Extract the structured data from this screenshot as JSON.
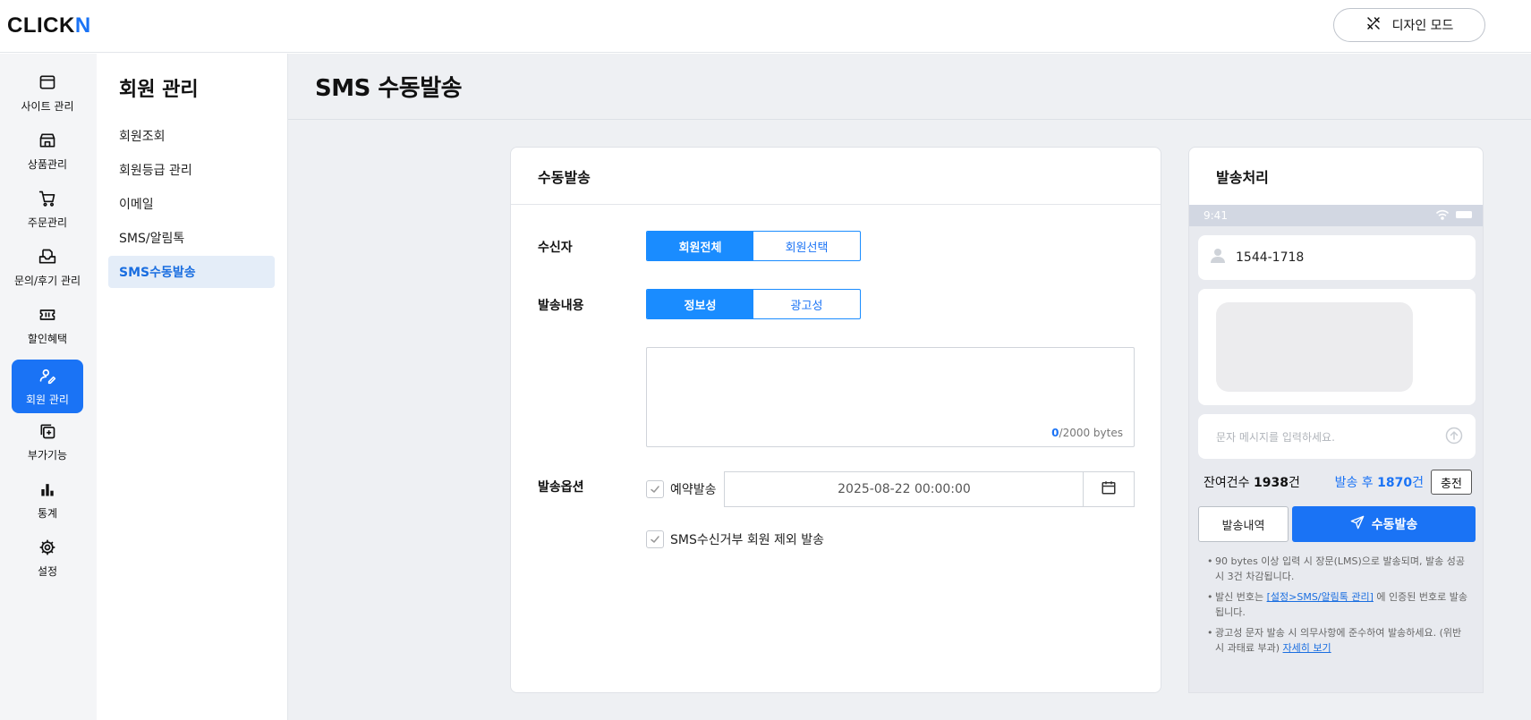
{
  "app": {
    "logo_main": "CLICK",
    "logo_accent": "N",
    "design_mode_label": "디자인 모드"
  },
  "rail": {
    "items": [
      {
        "label": "사이트 관리",
        "icon": "window-icon"
      },
      {
        "label": "상품관리",
        "icon": "store-icon"
      },
      {
        "label": "주문관리",
        "icon": "cart-icon"
      },
      {
        "label": "문의/후기 관리",
        "icon": "inbox-icon"
      },
      {
        "label": "할인혜택",
        "icon": "ticket-icon"
      },
      {
        "label": "회원 관리",
        "icon": "user-edit-icon",
        "active": true
      },
      {
        "label": "부가기능",
        "icon": "add-on-icon"
      },
      {
        "label": "통계",
        "icon": "bar-chart-icon"
      },
      {
        "label": "설정",
        "icon": "gear-icon"
      }
    ]
  },
  "subnav": {
    "title": "회원 관리",
    "items": [
      {
        "label": "회원조회"
      },
      {
        "label": "회원등급 관리"
      },
      {
        "label": "이메일"
      },
      {
        "label": "SMS/알림톡"
      },
      {
        "label": "SMS수동발송",
        "active": true
      }
    ]
  },
  "page": {
    "title": "SMS 수동발송"
  },
  "form": {
    "card_title": "수동발송",
    "recipient_label": "수신자",
    "recipient_options": [
      "회원전체",
      "회원선택"
    ],
    "recipient_selected": "회원전체",
    "content_label": "발송내용",
    "content_options": [
      "정보성",
      "광고성"
    ],
    "content_selected": "정보성",
    "message_value": "",
    "byte_current": "0",
    "byte_max": "/2000 bytes",
    "options_label": "발송옵션",
    "reserve_label": "예약발송",
    "reserve_checked": true,
    "reserve_datetime": "2025-08-22 00:00:00",
    "exclude_label": "SMS수신거부 회원 제외 발송",
    "exclude_checked": true
  },
  "preview": {
    "title": "발송처리",
    "status_time": "9:41",
    "sender_number": "1544-1718",
    "input_placeholder": "문자 메시지를 입력하세요.",
    "remaining_prefix": "잔여건수 ",
    "remaining_count": "1938",
    "remaining_suffix": "건",
    "after_prefix": "발송 후 ",
    "after_count": "1870",
    "after_suffix": "건",
    "charge_label": "충전",
    "history_label": "발송내역",
    "send_label": "수동발송",
    "note1": "90 bytes 이상 입력 시 장문(LMS)으로 발송되며, 발송 성공 시 3건 차감됩니다.",
    "note2_pre": "발신 번호는 ",
    "note2_link": "[설정>SMS/알림톡 관리]",
    "note2_post": " 에 인증된 번호로 발송 됩니다.",
    "note3_pre": "광고성 문자 발송 시 의무사항에 준수하여 발송하세요. (위반시 과태료 부과) ",
    "note3_link": "자세히 보기"
  },
  "colors": {
    "accent": "#1a73f5",
    "segment_active": "#1a8cff",
    "sidebar_active_bg": "#e4edf8",
    "main_bg": "#eef0f3"
  }
}
